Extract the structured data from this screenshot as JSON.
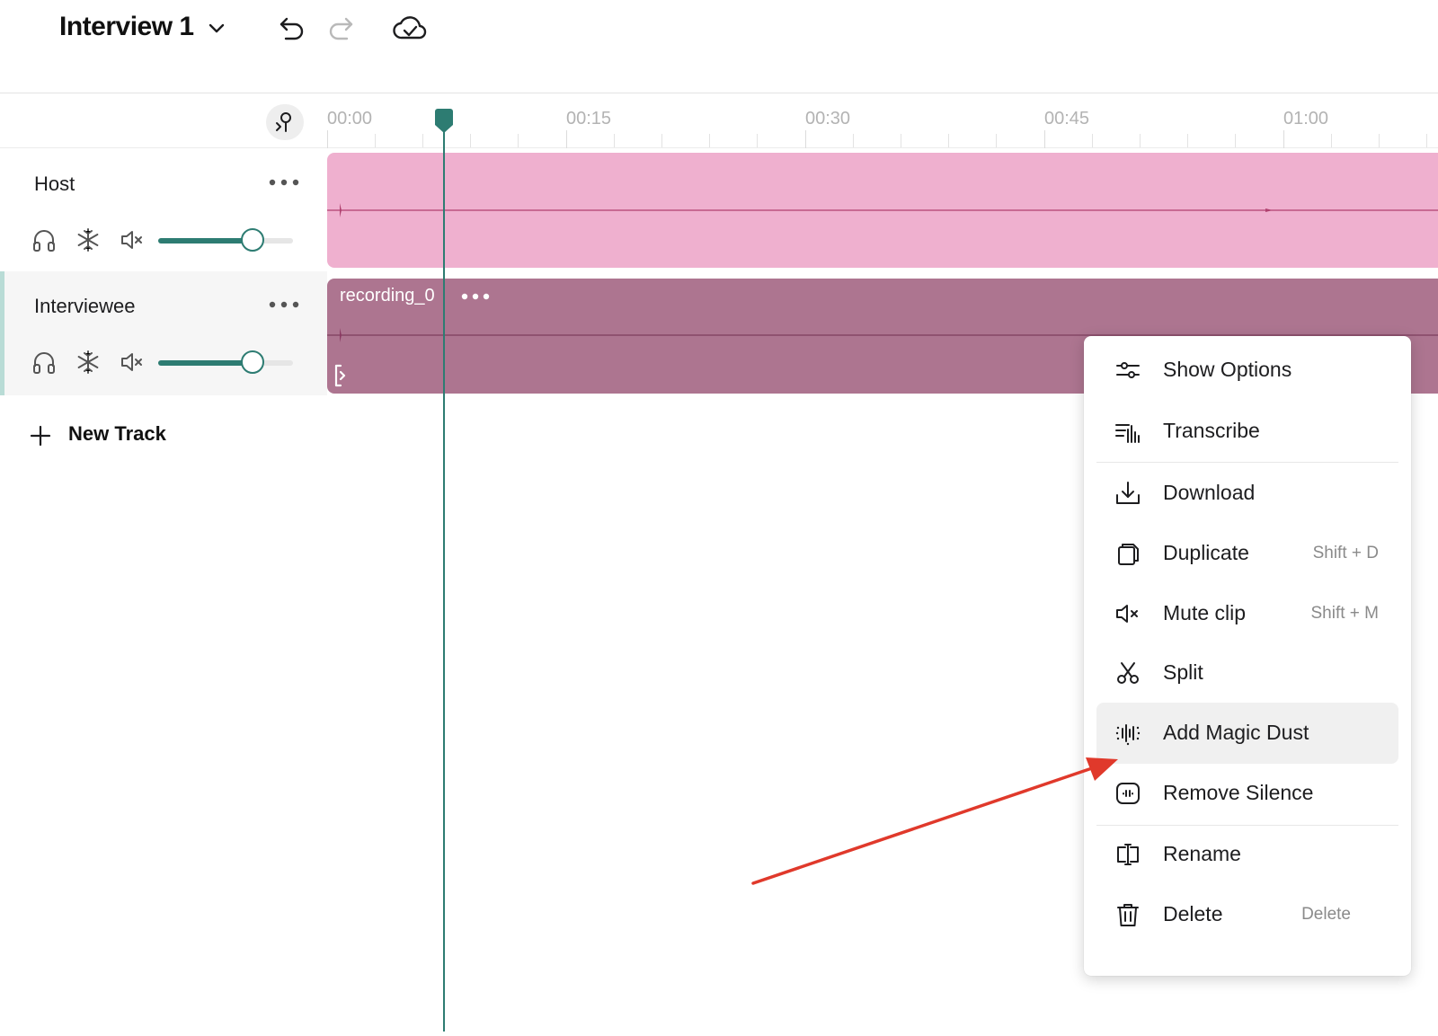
{
  "header": {
    "project_title": "Interview 1"
  },
  "ruler": {
    "ticks": [
      "00:00",
      "00:15",
      "00:30",
      "00:45",
      "01:00"
    ]
  },
  "tracks": [
    {
      "name": "Host",
      "volume_fraction": 0.7,
      "clip_color": "#efb0cf"
    },
    {
      "name": "Interviewee",
      "volume_fraction": 0.7,
      "clip_color": "#ad7590",
      "clip_name": "recording_0"
    }
  ],
  "new_track_label": "New Track",
  "context_menu": {
    "items": [
      {
        "label": "Show Options",
        "shortcut": "",
        "icon": "sliders-icon"
      },
      {
        "label": "Transcribe",
        "shortcut": "",
        "icon": "transcribe-icon"
      },
      {
        "label": "Download",
        "shortcut": "",
        "icon": "download-icon"
      },
      {
        "label": "Duplicate",
        "shortcut": "Shift + D",
        "icon": "duplicate-icon"
      },
      {
        "label": "Mute clip",
        "shortcut": "Shift + M",
        "icon": "mute-icon"
      },
      {
        "label": "Split",
        "shortcut": "",
        "icon": "scissors-icon"
      },
      {
        "label": "Add Magic Dust",
        "shortcut": "",
        "icon": "magic-dust-icon",
        "highlighted": true
      },
      {
        "label": "Remove Silence",
        "shortcut": "",
        "icon": "remove-silence-icon"
      },
      {
        "label": "Rename",
        "shortcut": "",
        "icon": "rename-icon"
      },
      {
        "label": "Delete",
        "shortcut": "Delete",
        "icon": "trash-icon"
      }
    ]
  },
  "colors": {
    "accent": "#2d7c72",
    "annotation_arrow": "#e0392b"
  }
}
